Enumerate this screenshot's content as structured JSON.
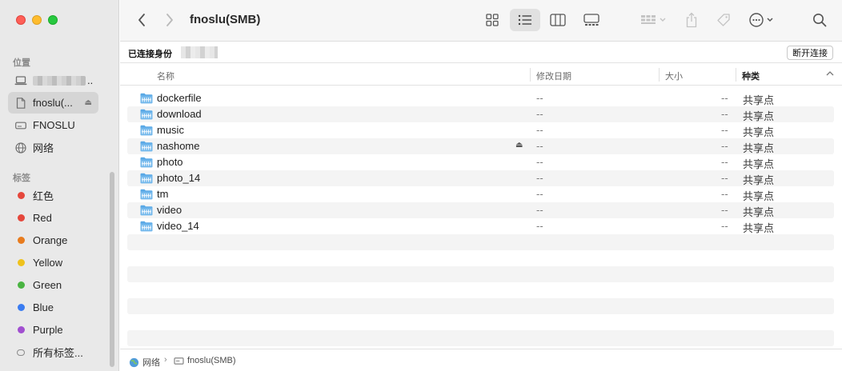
{
  "window": {
    "title": "fnoslu(SMB)"
  },
  "sidebar": {
    "locations_header": "位置",
    "locations": [
      {
        "label": "..",
        "icon": "laptop-icon",
        "obscured": true
      },
      {
        "label": "fnoslu(...",
        "icon": "document-icon",
        "selected": true,
        "ejectable": true
      },
      {
        "label": "FNOSLU",
        "icon": "drive-icon"
      },
      {
        "label": "网络",
        "icon": "globe-icon"
      }
    ],
    "tags_header": "标签",
    "tags": [
      {
        "label": "红色",
        "color": "#e5473c"
      },
      {
        "label": "Red",
        "color": "#e5473c"
      },
      {
        "label": "Orange",
        "color": "#e87c1e"
      },
      {
        "label": "Yellow",
        "color": "#efc21c"
      },
      {
        "label": "Green",
        "color": "#4ab442"
      },
      {
        "label": "Blue",
        "color": "#3a7cf1"
      },
      {
        "label": "Purple",
        "color": "#a14fd0"
      },
      {
        "label": "所有标签...",
        "color": ""
      }
    ]
  },
  "toolbar": {
    "back_icon": "chevron-left-icon",
    "forward_icon": "chevron-right-icon",
    "views": [
      "icon-view",
      "list-view",
      "column-view",
      "gallery-view"
    ],
    "active_view": "list-view",
    "actions": [
      "group-icon",
      "share-icon",
      "tag-icon",
      "more-icon",
      "search-icon"
    ]
  },
  "connection": {
    "label": "已连接身份",
    "disconnect_label": "断开连接"
  },
  "columns": {
    "name": "名称",
    "date": "修改日期",
    "size": "大小",
    "kind": "种类"
  },
  "files": [
    {
      "name": "dockerfile",
      "date": "--",
      "size": "--",
      "kind": "共享点"
    },
    {
      "name": "download",
      "date": "--",
      "size": "--",
      "kind": "共享点"
    },
    {
      "name": "music",
      "date": "--",
      "size": "--",
      "kind": "共享点"
    },
    {
      "name": "nashome",
      "date": "--",
      "size": "--",
      "kind": "共享点",
      "ejectable": true
    },
    {
      "name": "photo",
      "date": "--",
      "size": "--",
      "kind": "共享点"
    },
    {
      "name": "photo_14",
      "date": "--",
      "size": "--",
      "kind": "共享点"
    },
    {
      "name": "tm",
      "date": "--",
      "size": "--",
      "kind": "共享点"
    },
    {
      "name": "video",
      "date": "--",
      "size": "--",
      "kind": "共享点"
    },
    {
      "name": "video_14",
      "date": "--",
      "size": "--",
      "kind": "共享点"
    }
  ],
  "pathbar": {
    "items": [
      "网络",
      "fnoslu(SMB)"
    ],
    "separator": "›"
  },
  "colors": {
    "folder": "#5aa9e6",
    "folder_dark": "#3f8fd2",
    "row_stripe": "#f4f4f4"
  }
}
